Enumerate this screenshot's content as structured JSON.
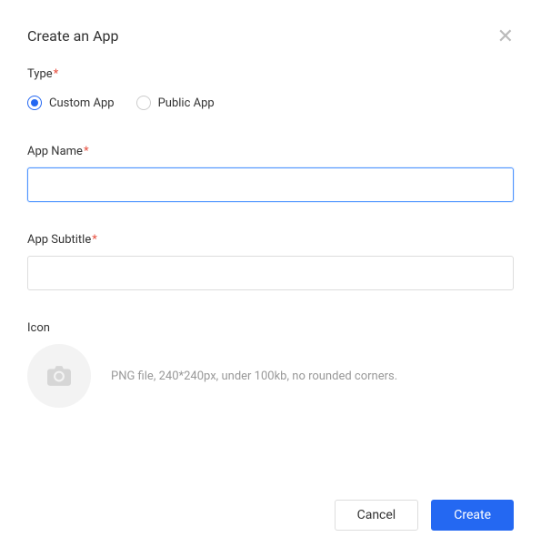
{
  "dialog": {
    "title": "Create an App"
  },
  "type": {
    "label": "Type",
    "options": {
      "custom": "Custom App",
      "public": "Public App"
    },
    "selected": "custom"
  },
  "appName": {
    "label": "App Name",
    "value": ""
  },
  "appSubtitle": {
    "label": "App Subtitle",
    "value": ""
  },
  "icon": {
    "label": "Icon",
    "hint": "PNG file, 240*240px, under 100kb, no rounded corners."
  },
  "buttons": {
    "cancel": "Cancel",
    "create": "Create"
  }
}
